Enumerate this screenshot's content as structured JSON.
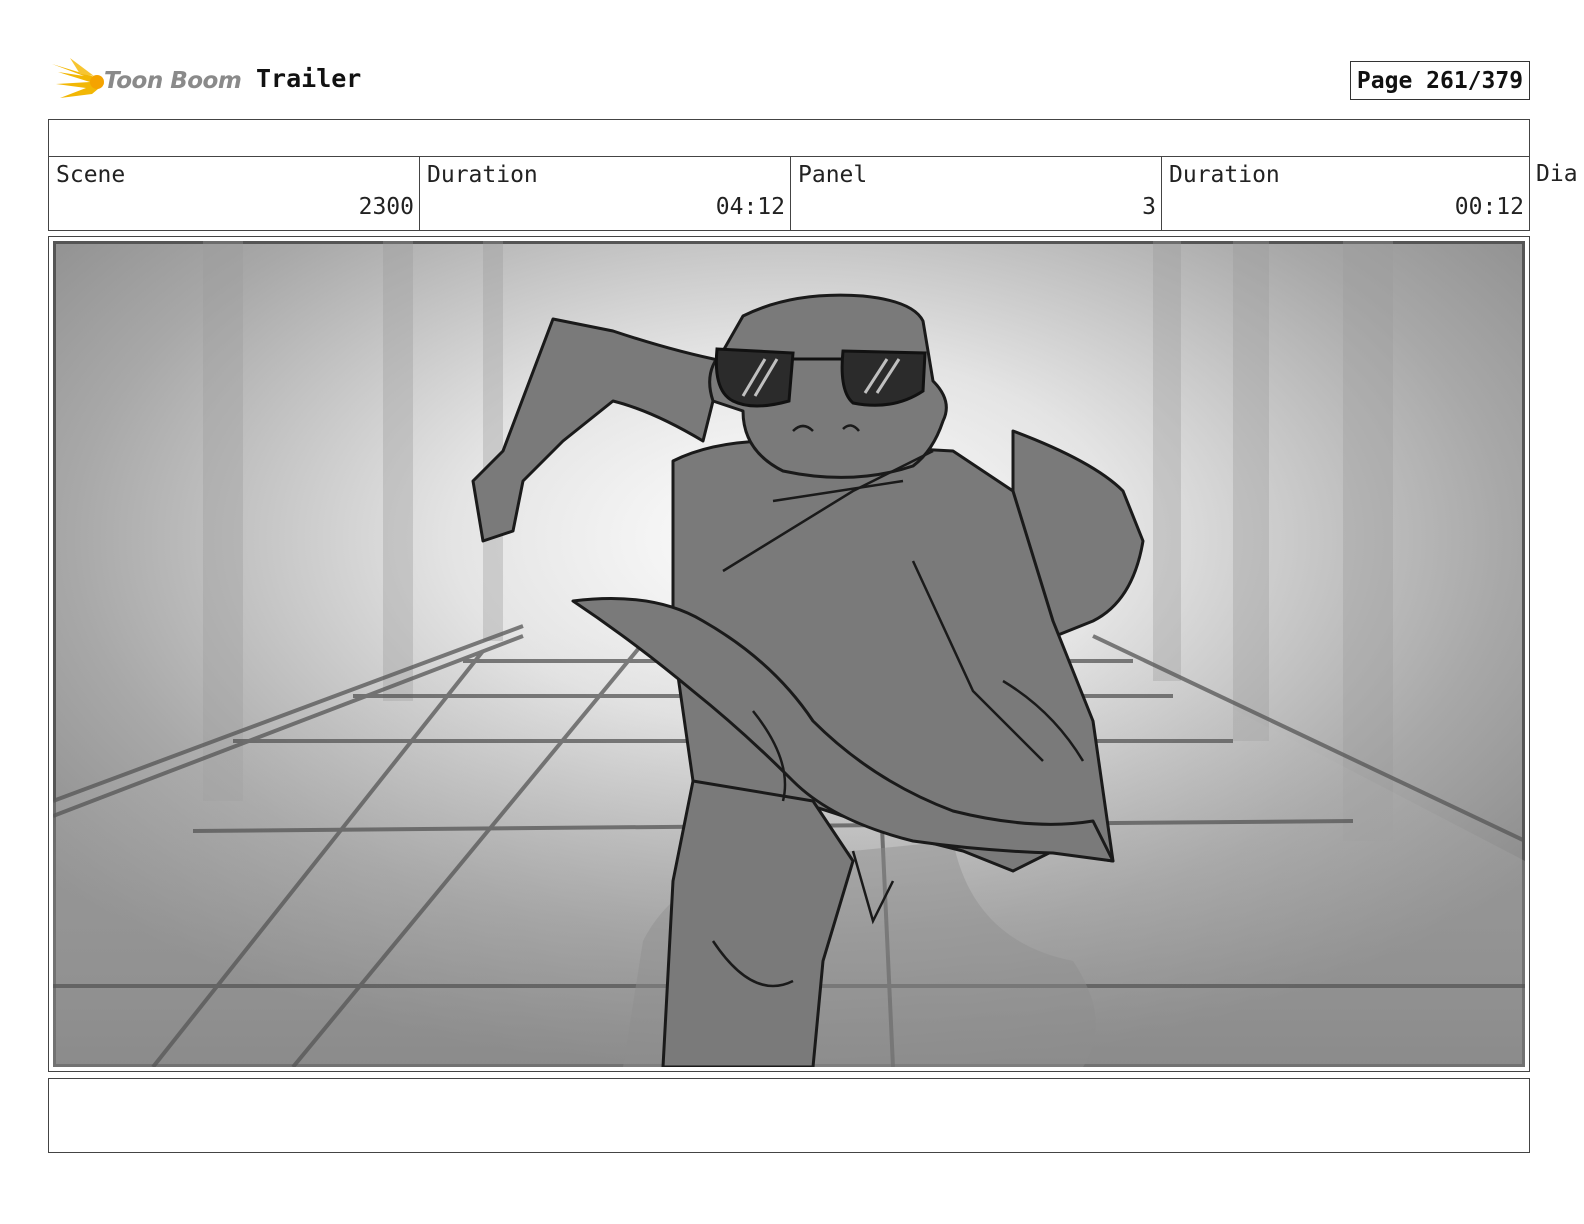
{
  "header": {
    "logo_text": "Toon Boom",
    "project_title": "Trailer",
    "page_label": "Page 261/379"
  },
  "info": {
    "scene_label": "Scene",
    "scene_value": "2300",
    "scene_duration_label": "Duration",
    "scene_duration_value": "04:12",
    "panel_label": "Panel",
    "panel_value": "3",
    "panel_duration_label": "Duration",
    "panel_duration_value": "00:12",
    "dialogue_label_partial": "Dia"
  },
  "panel_image": {
    "subject": "sketch of a running reptile character wearing sunglasses and a jacket in a glowing tiled corridor"
  },
  "icons": [
    "toon-boom-logo-icon"
  ],
  "colors": {
    "logo_accent": "#f2b705",
    "sketch_fill": "#7a7a7a",
    "background": "#ffffff"
  }
}
